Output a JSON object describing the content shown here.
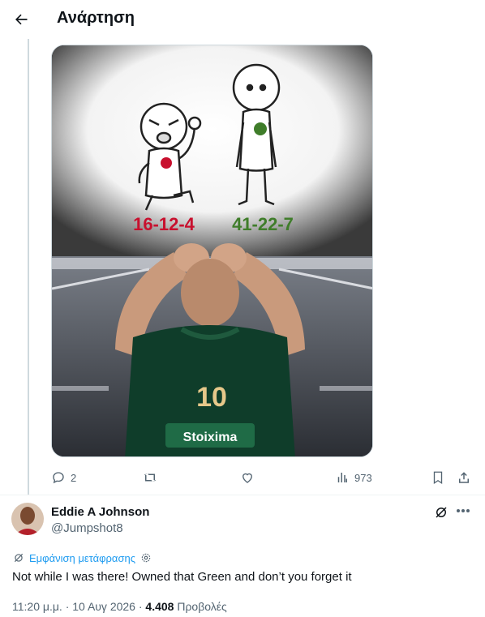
{
  "header": {
    "title": "Ανάρτηση",
    "back_icon": "arrow-left-icon"
  },
  "media": {
    "score_left": "16-12-4",
    "score_right": "41-22-7",
    "score_left_color": "#c8102e",
    "score_right_color": "#3f7d2a",
    "jersey_number": "10",
    "jersey_sponsor": "Stoixima",
    "jersey_color": "#0f3d2a"
  },
  "actions": {
    "reply_count": "2",
    "repost_count": "",
    "like_count": "",
    "views_count": "973"
  },
  "reply": {
    "name": "Eddie A Johnson",
    "handle": "@Jumpshot8",
    "translate_label": "Εμφάνιση μετάφρασης",
    "text": "Not while I was there!  Owned that Green and don’t you forget it",
    "time": "11:20 μ.μ.",
    "date": "10 Αυγ 2026",
    "views": "4.408",
    "views_label": "Προβολές"
  },
  "colors": {
    "accent": "#1d9bf0",
    "muted": "#536471",
    "text": "#0f1419"
  }
}
